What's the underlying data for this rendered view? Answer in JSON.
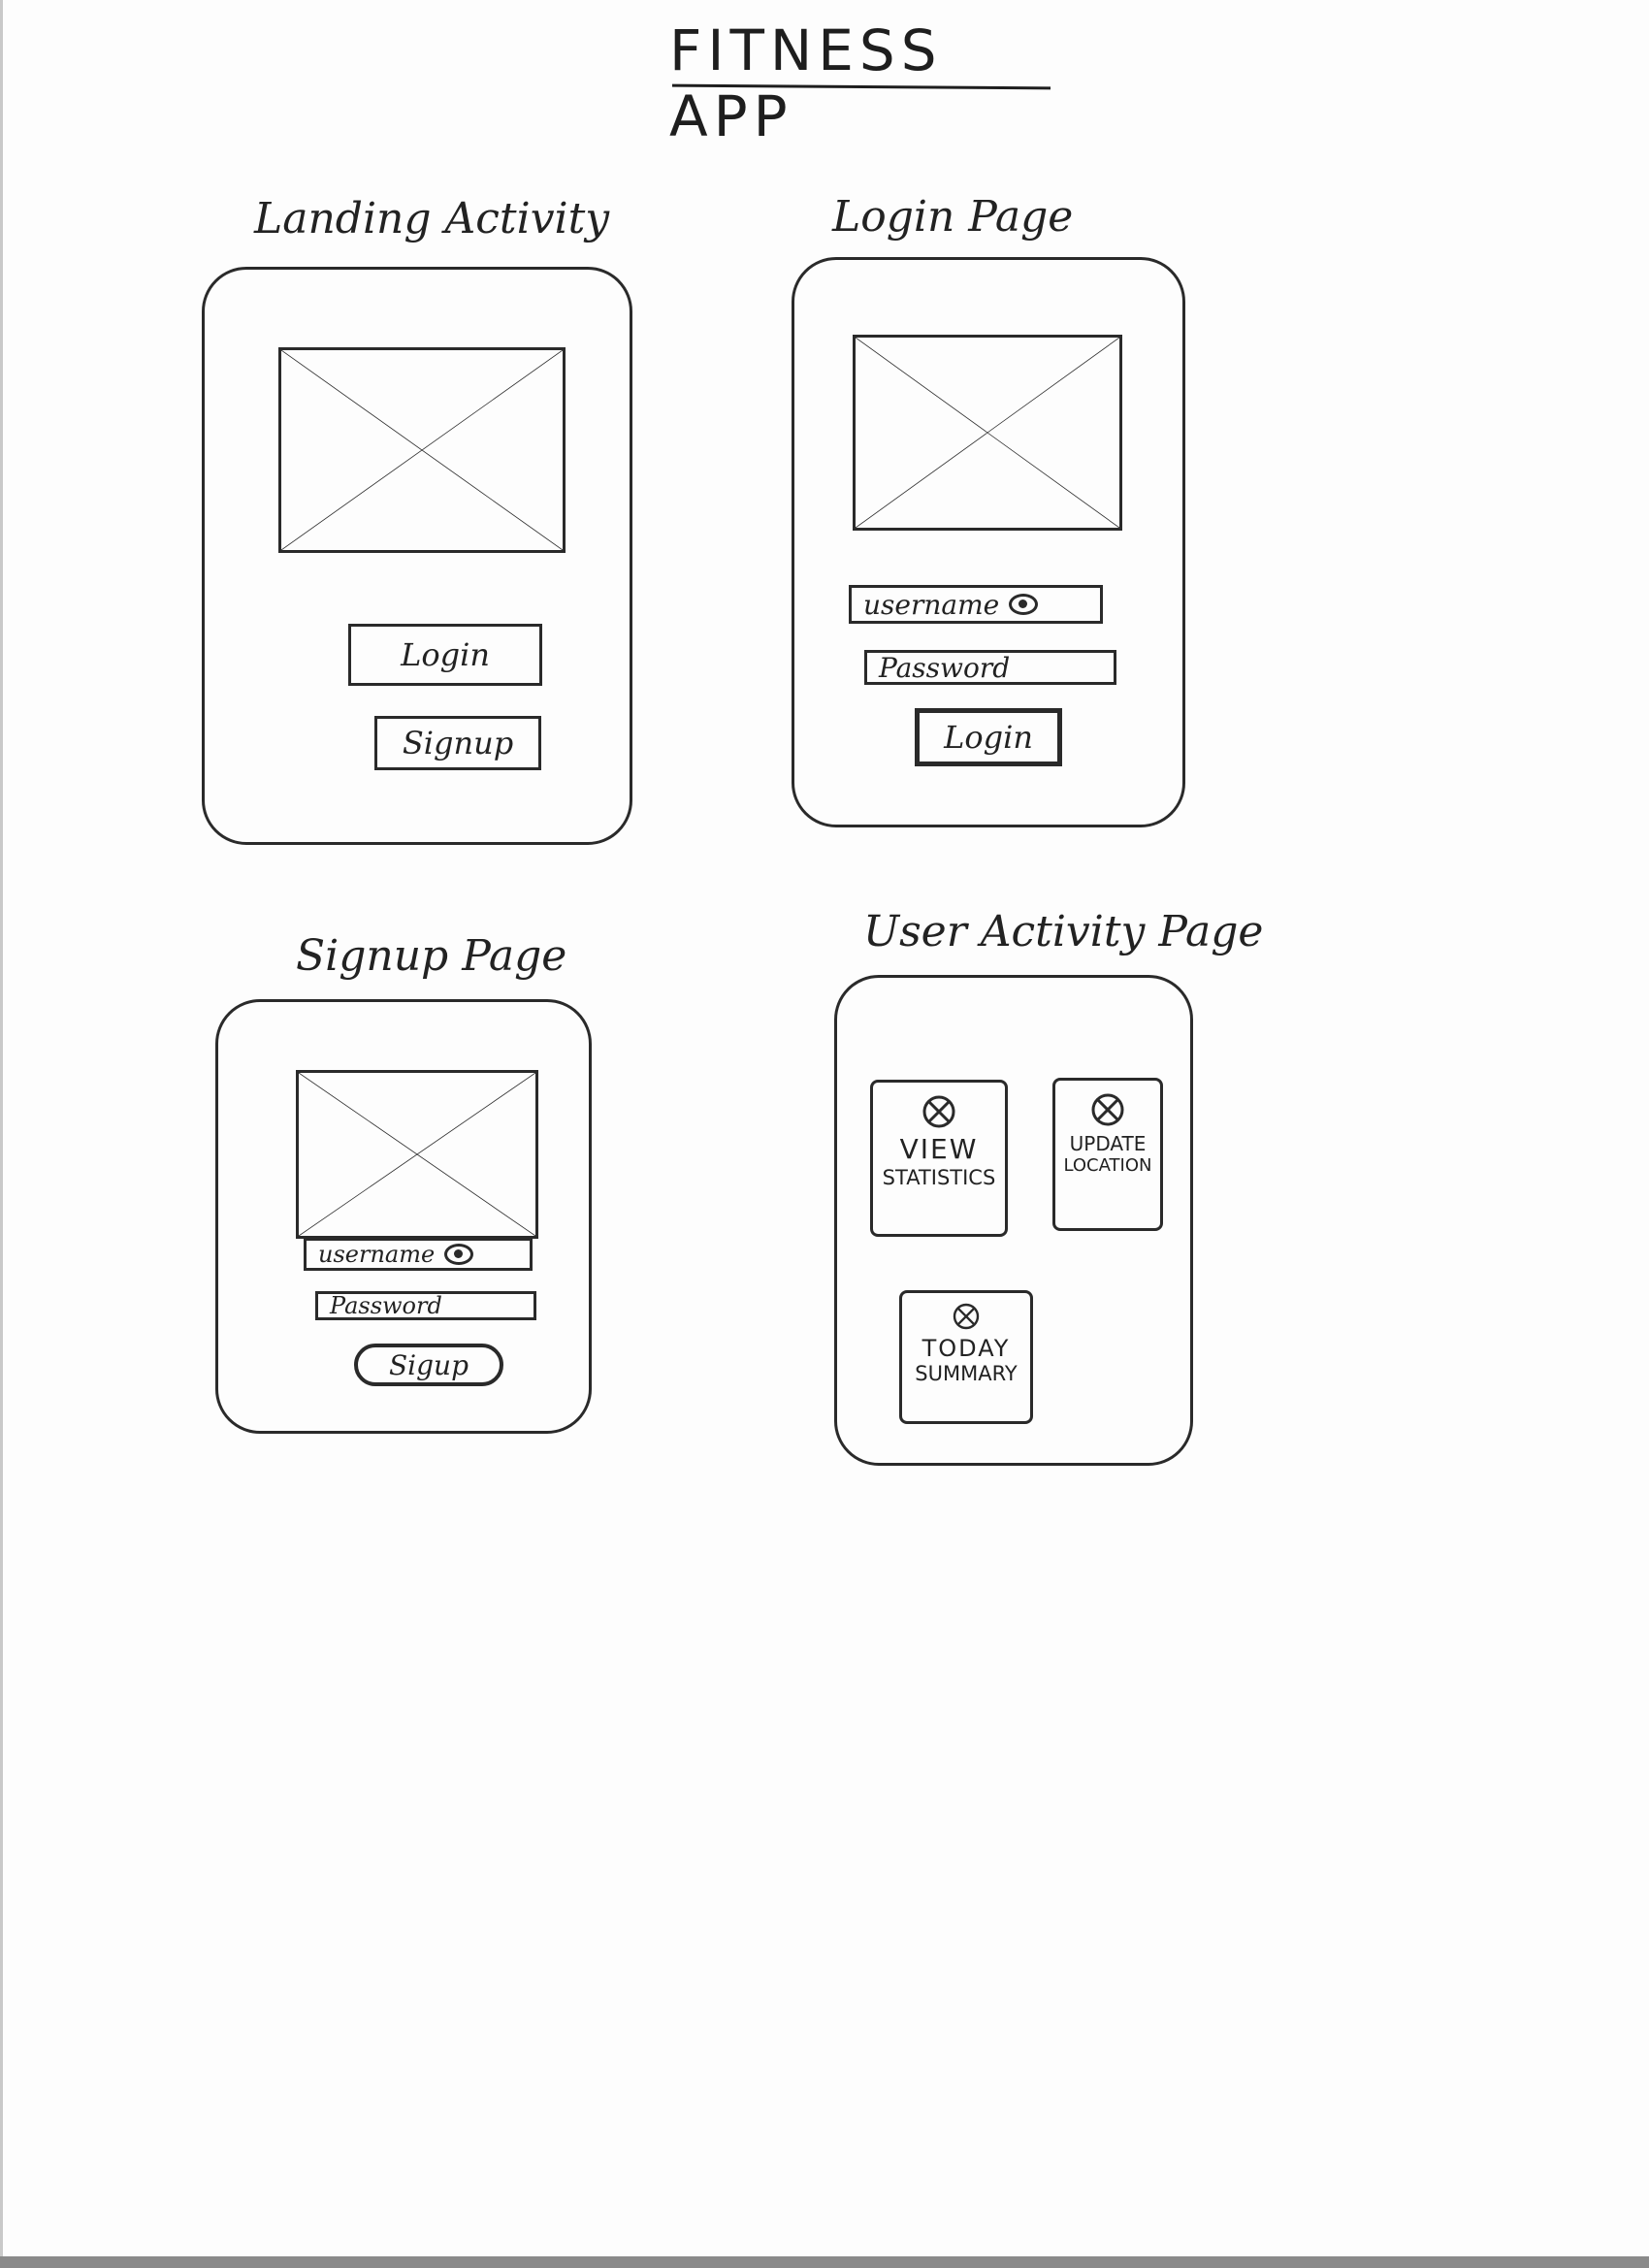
{
  "title": "FITNESS APP",
  "screens": {
    "landing": {
      "label": "Landing Activity",
      "login_button": "Login",
      "signup_button": "Signup"
    },
    "login": {
      "label": "Login Page",
      "username_field": "username",
      "password_field": "Password",
      "login_button": "Login"
    },
    "signup": {
      "label": "Signup Page",
      "username_field": "username",
      "password_field": "Password",
      "signup_button": "Sigup"
    },
    "user_activity": {
      "label": "User Activity Page",
      "tiles": [
        {
          "line1": "VIEW",
          "line2": "STATISTICS",
          "icon": "crossed-circle-icon"
        },
        {
          "line1": "UPDATE",
          "line2": "LOCATION",
          "icon": "crossed-circle-icon"
        },
        {
          "line1": "TODAY",
          "line2": "SUMMARY",
          "icon": "crossed-circle-icon"
        }
      ]
    }
  }
}
